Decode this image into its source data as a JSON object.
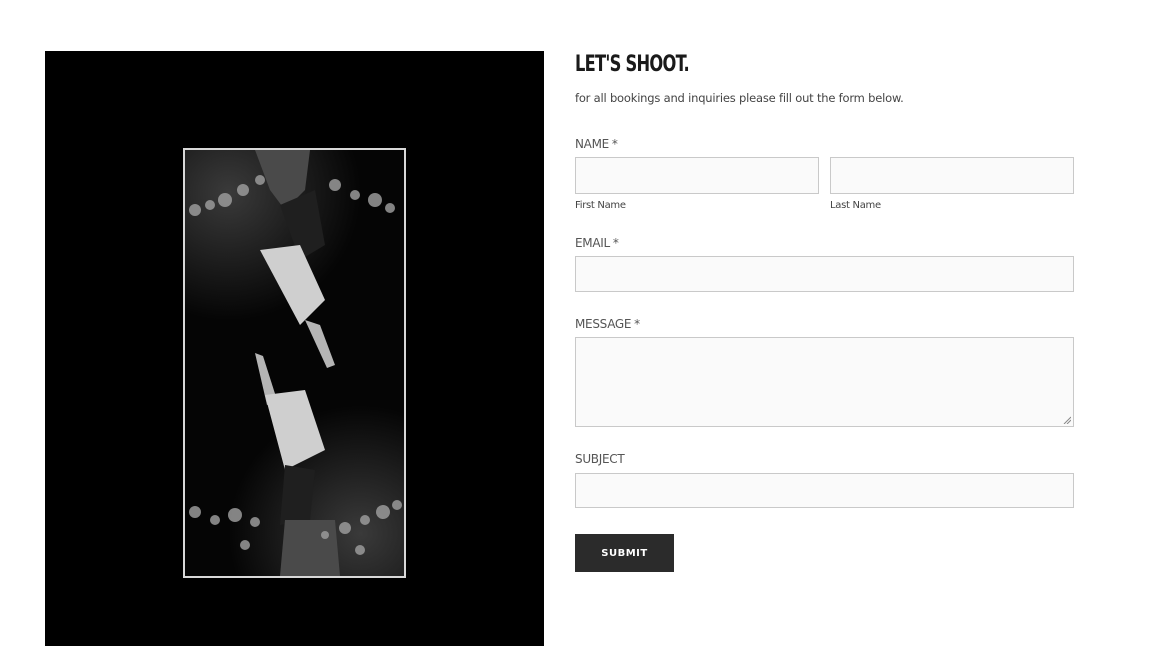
{
  "photo": {
    "description_icon": "photo-image",
    "colors": {
      "panel": "#000000",
      "frame": "#d8d8d8"
    }
  },
  "form": {
    "heading": "LET'S SHOOT.",
    "intro": "for all bookings and inquiries please fill out the form below.",
    "name": {
      "label": "NAME",
      "required_mark": "*",
      "first_sublabel": "First Name",
      "last_sublabel": "Last Name",
      "first_value": "",
      "last_value": ""
    },
    "email": {
      "label": "EMAIL",
      "required_mark": "*",
      "value": ""
    },
    "message": {
      "label": "MESSAGE",
      "required_mark": "*",
      "value": ""
    },
    "subject": {
      "label": "SUBJECT",
      "value": ""
    },
    "submit_label": "SUBMIT"
  },
  "colors": {
    "button_bg": "#2b2b2b",
    "input_bg": "#fafafa",
    "input_border": "#c9c9c9"
  }
}
